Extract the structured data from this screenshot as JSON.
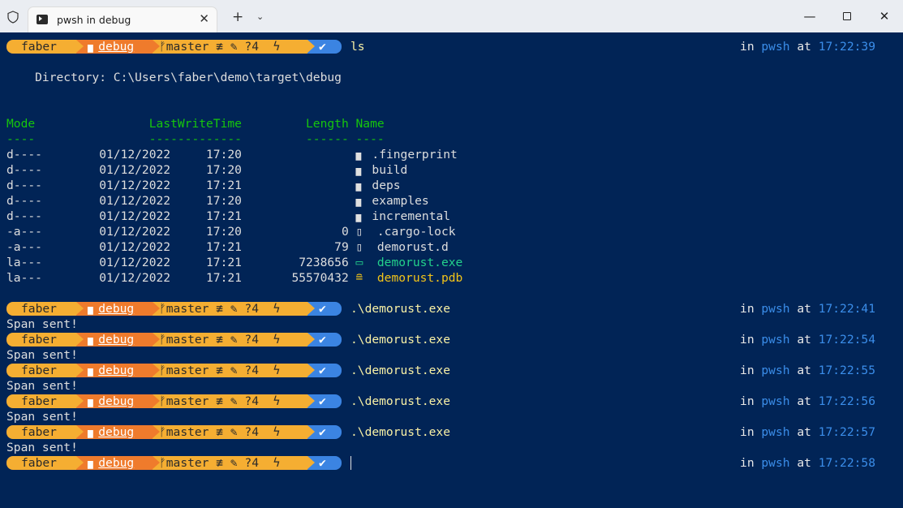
{
  "window": {
    "tab_title": "pwsh in debug",
    "tab_close": "✕",
    "new_tab": "+",
    "dropdown": "⌄",
    "minimize": "—",
    "close": "✕",
    "icons": [
      "shield-icon",
      "powershell-icon",
      "close-icon",
      "plus-icon",
      "chevron-down-icon",
      "minimize-icon",
      "maximize-icon",
      "close-window-icon"
    ]
  },
  "prompt": {
    "user": "faber",
    "folder_icon": "▆",
    "path": "debug",
    "git": "ᚠmaster ≢ ✎ ?4",
    "bolt": "ϟ",
    "ok": "✔",
    "in_label": "in",
    "shell": "pwsh",
    "at_label": "at",
    "colors": {
      "user_bg": "#f5ae32",
      "path_bg": "#ef7b2c",
      "ok_bg": "#3b84e2",
      "time": "#3b8eea"
    }
  },
  "first_command": {
    "cmd": "ls",
    "time": "17:22:39"
  },
  "directory_line": "    Directory: C:\\Users\\faber\\demo\\target\\debug",
  "listing": {
    "headers": {
      "mode": "Mode",
      "lastwrite": "LastWriteTime",
      "length": "Length",
      "name": "Name"
    },
    "underlines": {
      "mode": "----",
      "lastwrite": "-------------",
      "length": "------",
      "name": "----"
    },
    "rows": [
      {
        "mode": "d----",
        "date": "01/12/2022",
        "time": "17:20",
        "length": "",
        "icon": "▆",
        "name": ".fingerprint",
        "kind": "dir"
      },
      {
        "mode": "d----",
        "date": "01/12/2022",
        "time": "17:20",
        "length": "",
        "icon": "▆",
        "name": "build",
        "kind": "dir"
      },
      {
        "mode": "d----",
        "date": "01/12/2022",
        "time": "17:21",
        "length": "",
        "icon": "▆",
        "name": "deps",
        "kind": "dir"
      },
      {
        "mode": "d----",
        "date": "01/12/2022",
        "time": "17:20",
        "length": "",
        "icon": "▆",
        "name": "examples",
        "kind": "dir"
      },
      {
        "mode": "d----",
        "date": "01/12/2022",
        "time": "17:21",
        "length": "",
        "icon": "▆",
        "name": "incremental",
        "kind": "dir"
      },
      {
        "mode": "-a---",
        "date": "01/12/2022",
        "time": "17:20",
        "length": "0",
        "icon": "▯",
        "name": ".cargo-lock",
        "kind": "file"
      },
      {
        "mode": "-a---",
        "date": "01/12/2022",
        "time": "17:21",
        "length": "79",
        "icon": "▯",
        "name": "demorust.d",
        "kind": "file"
      },
      {
        "mode": "la---",
        "date": "01/12/2022",
        "time": "17:21",
        "length": "7238656",
        "icon": "▭",
        "name": "demorust.exe",
        "kind": "exe"
      },
      {
        "mode": "la---",
        "date": "01/12/2022",
        "time": "17:21",
        "length": "55570432",
        "icon": "≘",
        "name": "demorust.pdb",
        "kind": "pdb"
      }
    ]
  },
  "runs": [
    {
      "cmd": ".\\demorust.exe",
      "time": "17:22:41",
      "output": "Span sent!"
    },
    {
      "cmd": ".\\demorust.exe",
      "time": "17:22:54",
      "output": "Span sent!"
    },
    {
      "cmd": ".\\demorust.exe",
      "time": "17:22:55",
      "output": "Span sent!"
    },
    {
      "cmd": ".\\demorust.exe",
      "time": "17:22:56",
      "output": "Span sent!"
    },
    {
      "cmd": ".\\demorust.exe",
      "time": "17:22:57",
      "output": "Span sent!"
    }
  ],
  "last_prompt": {
    "cmd": "",
    "time": "17:22:58"
  }
}
